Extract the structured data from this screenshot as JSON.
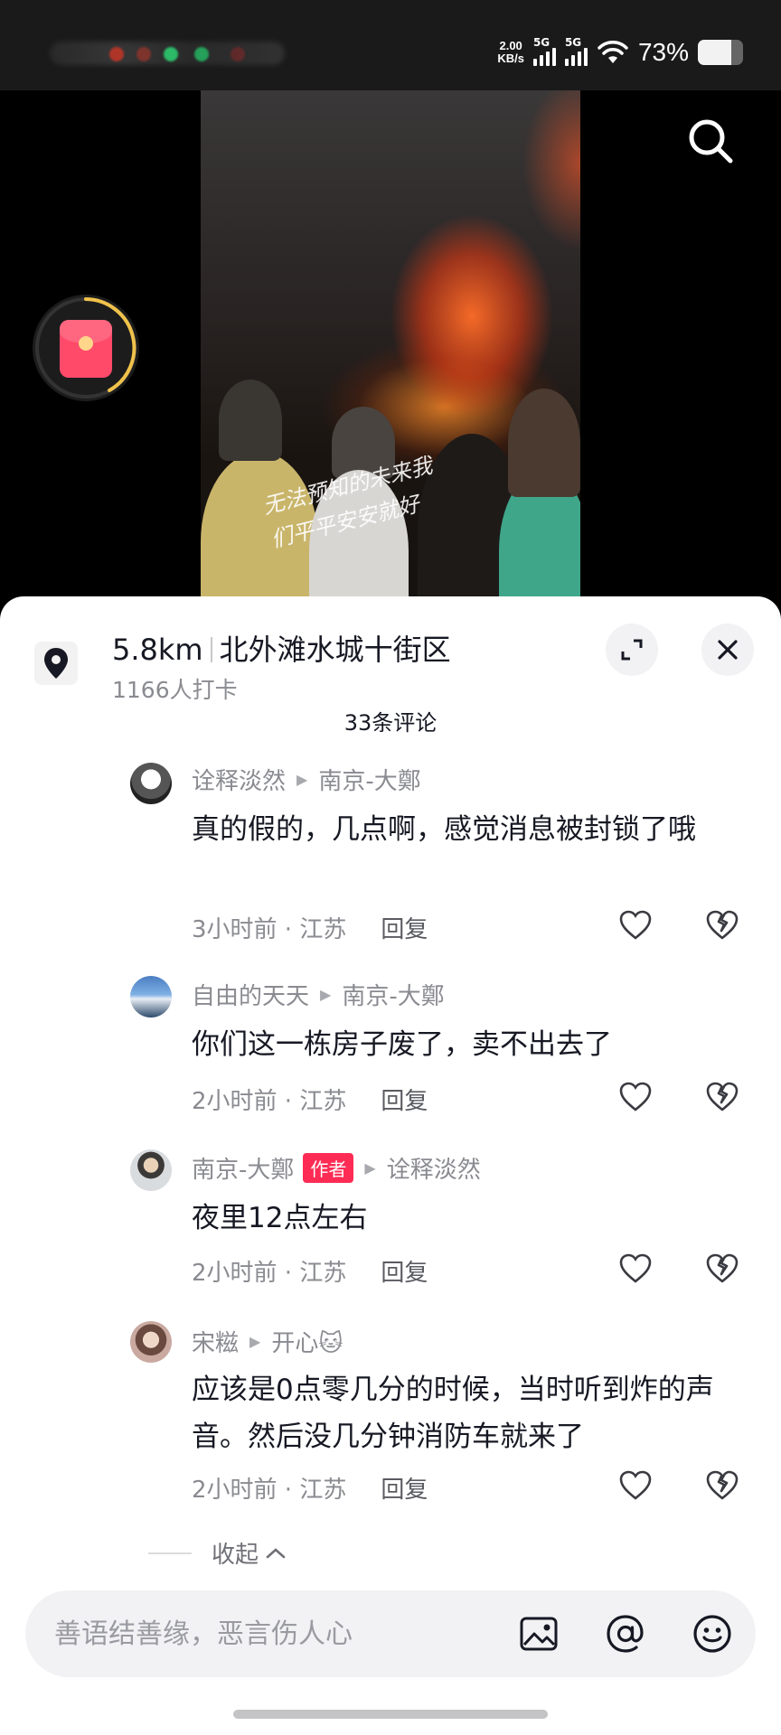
{
  "status_bar": {
    "net_speed": "2.00",
    "net_unit": "KB/s",
    "sim1": "5G",
    "sim2": "5G",
    "battery": "73%",
    "battery_level": 0.73
  },
  "video": {
    "caption_line1": "无法预知的未来我",
    "caption_line2": "们平平安安就好"
  },
  "location": {
    "distance": "5.8km",
    "name": "北外滩水城十街区",
    "checkins": "1166人打卡"
  },
  "comment_count": "33条评论",
  "comments": [
    {
      "user": "诠释淡然",
      "reply_to": "南京-大鄭",
      "author_tag": "",
      "text": "真的假的，几点啊，感觉消息被封锁了哦",
      "time_loc": "3小时前 · 江苏",
      "reply": "回复"
    },
    {
      "user": "自由的天天",
      "reply_to": "南京-大鄭",
      "author_tag": "",
      "text": "你们这一栋房子废了，卖不出去了",
      "time_loc": "2小时前 · 江苏",
      "reply": "回复"
    },
    {
      "user": "南京-大鄭",
      "reply_to": "诠释淡然",
      "author_tag": "作者",
      "text": "夜里12点左右",
      "time_loc": "2小时前 · 江苏",
      "reply": "回复"
    },
    {
      "user": "宋糍",
      "reply_to": "开心🐱",
      "author_tag": "",
      "text": "应该是0点零几分的时候，当时听到炸的声音。然后没几分钟消防车就来了",
      "time_loc": "2小时前 · 江苏",
      "reply": "回复"
    }
  ],
  "collapse_label": "收起",
  "input": {
    "placeholder": "善语结善缘，恶言伤人心"
  },
  "colors": {
    "accent": "#fe2c55",
    "secondary_text": "#8a8b91"
  }
}
